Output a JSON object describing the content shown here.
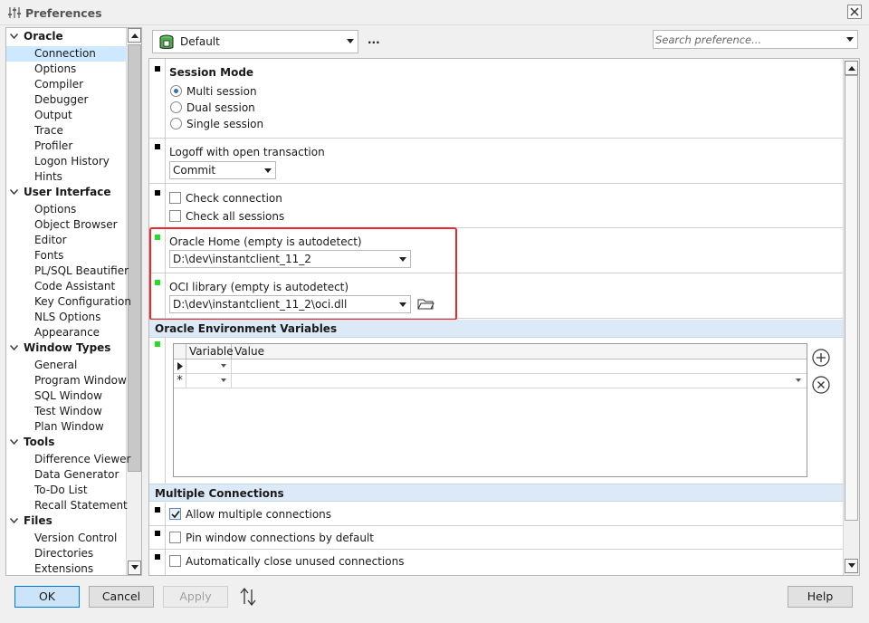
{
  "window": {
    "title": "Preferences"
  },
  "tree": {
    "categories": [
      {
        "label": "Oracle",
        "items": [
          "Connection",
          "Options",
          "Compiler",
          "Debugger",
          "Output",
          "Trace",
          "Profiler",
          "Logon History",
          "Hints"
        ]
      },
      {
        "label": "User Interface",
        "items": [
          "Options",
          "Object Browser",
          "Editor",
          "Fonts",
          "PL/SQL Beautifier",
          "Code Assistant",
          "Key Configuration",
          "NLS Options",
          "Appearance"
        ]
      },
      {
        "label": "Window Types",
        "items": [
          "General",
          "Program Window",
          "SQL Window",
          "Test Window",
          "Plan Window"
        ]
      },
      {
        "label": "Tools",
        "items": [
          "Difference Viewer",
          "Data Generator",
          "To-Do List",
          "Recall Statement"
        ]
      },
      {
        "label": "Files",
        "items": [
          "Version Control",
          "Directories",
          "Extensions"
        ]
      }
    ],
    "selected": "Connection"
  },
  "toolbar": {
    "profile": "Default",
    "more": "...",
    "search_placeholder": "Search preference..."
  },
  "session_mode": {
    "title": "Session Mode",
    "options": [
      "Multi session",
      "Dual session",
      "Single session"
    ],
    "selected": "Multi session"
  },
  "logoff": {
    "label": "Logoff with open transaction",
    "value": "Commit"
  },
  "checks": {
    "check_connection": "Check connection",
    "check_all_sessions": "Check all sessions"
  },
  "oracle_home": {
    "label": "Oracle Home (empty is autodetect)",
    "value": "D:\\dev\\instantclient_11_2"
  },
  "oci_library": {
    "label": "OCI library (empty is autodetect)",
    "value": "D:\\dev\\instantclient_11_2\\oci.dll"
  },
  "env_vars": {
    "title": "Oracle Environment Variables",
    "columns": [
      "Variable",
      "Value"
    ],
    "new_row_marker": "*"
  },
  "multiple_connections": {
    "title": "Multiple Connections",
    "allow": "Allow multiple connections",
    "allow_checked": true,
    "pin": "Pin window connections by default",
    "auto_close": "Automatically close unused connections"
  },
  "buttons": {
    "ok": "OK",
    "cancel": "Cancel",
    "apply": "Apply",
    "help": "Help"
  },
  "colors": {
    "selection": "#cde8ff",
    "section_header": "#dce9f7",
    "highlight_box": "#e8292e",
    "green_marker": "#21e021"
  }
}
